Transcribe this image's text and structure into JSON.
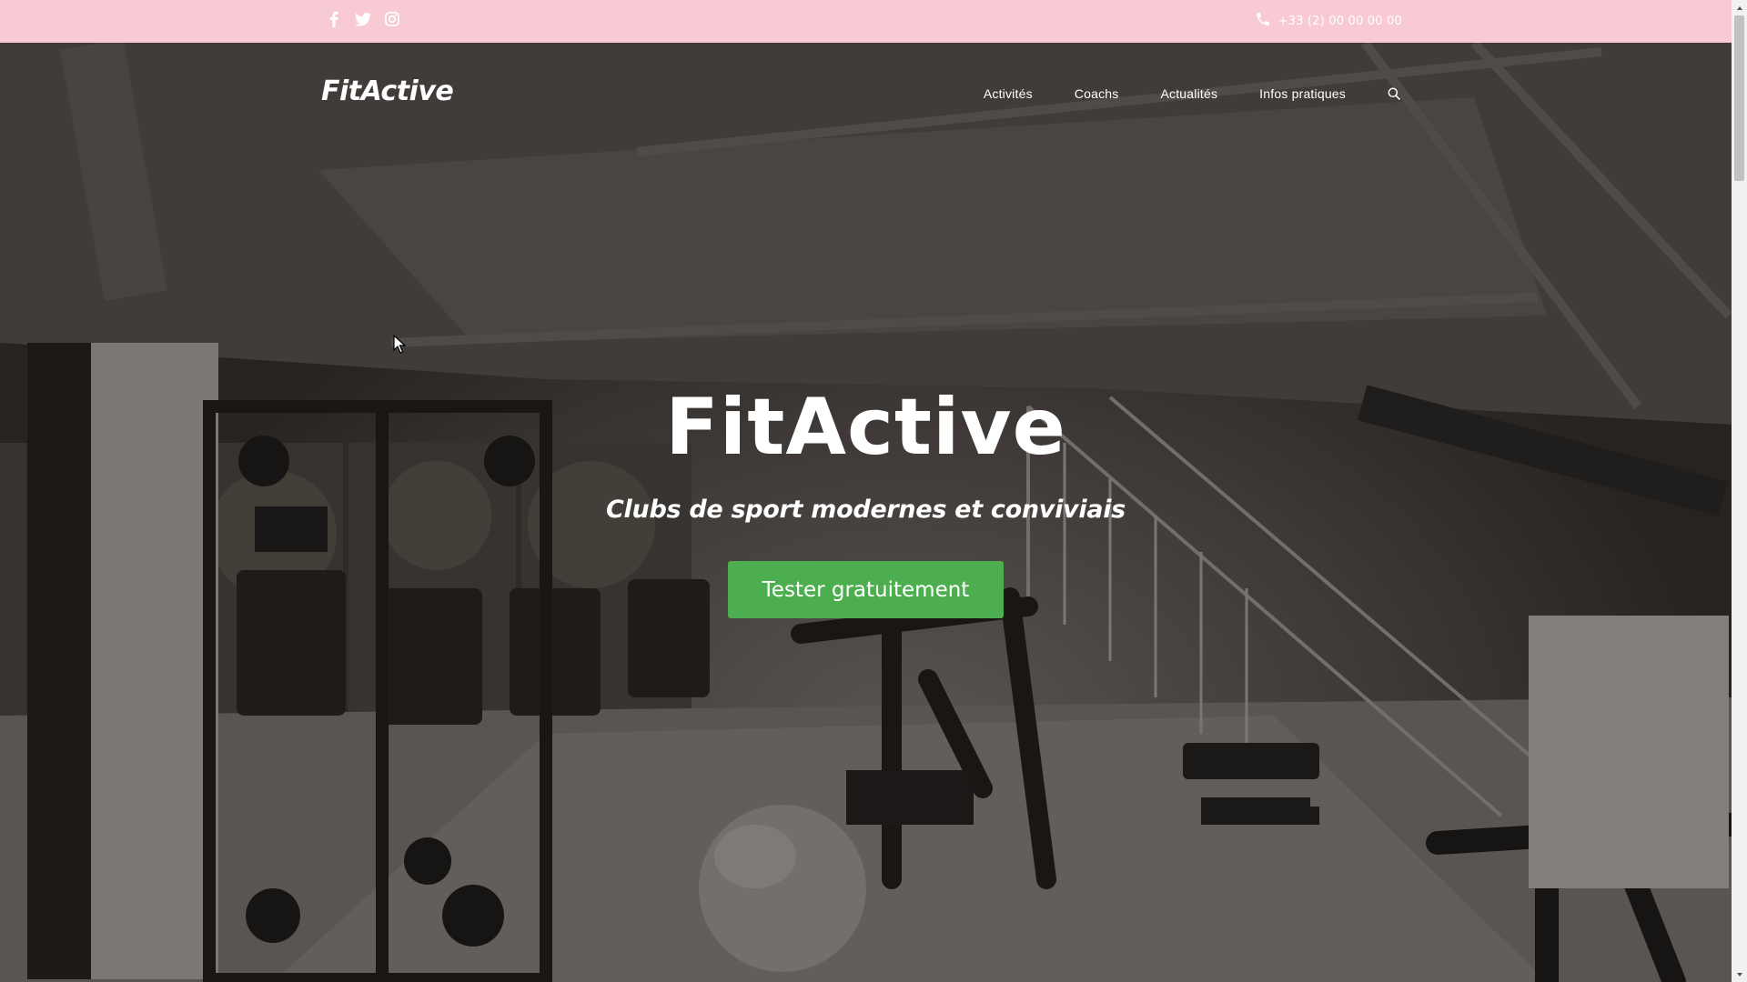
{
  "topbar": {
    "social": [
      {
        "icon": "facebook-icon"
      },
      {
        "icon": "twitter-icon"
      },
      {
        "icon": "instagram-icon"
      }
    ],
    "phone_icon": "phone-icon",
    "phone": "+33 (2) 00 00 00 00"
  },
  "header": {
    "logo": "FitActive",
    "nav": [
      {
        "label": "Activités"
      },
      {
        "label": "Coachs"
      },
      {
        "label": "Actualités"
      },
      {
        "label": "Infos pratiques"
      }
    ],
    "search_icon": "search-icon"
  },
  "hero": {
    "title": "FitActive",
    "subtitle": "Clubs de sport modernes et conviviais",
    "cta": "Tester gratuitement"
  },
  "colors": {
    "topbar_bg": "#f8cad4",
    "cta_bg": "#4cae4f",
    "text": "#ffffff"
  }
}
